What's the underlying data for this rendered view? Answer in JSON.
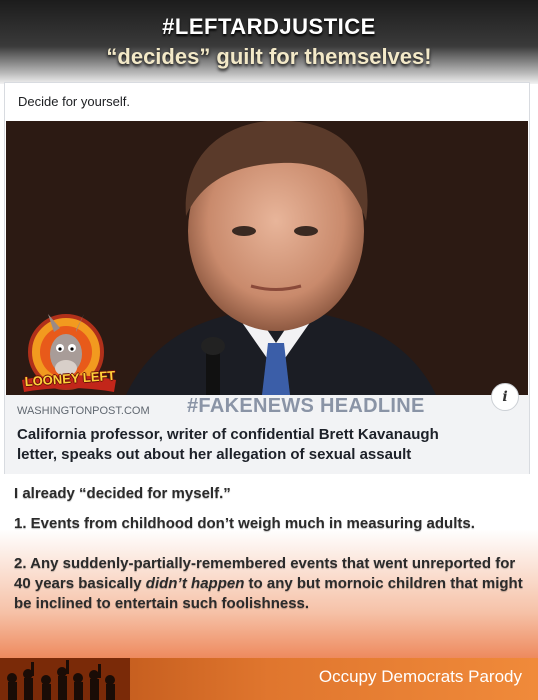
{
  "banner": {
    "line1": "#LEFTARDJUSTICE",
    "line2": "“decides” guilt for themselves!"
  },
  "post": {
    "caption": "Decide for yourself.",
    "domain": "WASHINGTONPOST.COM",
    "stamp": "#FAKENEWS HEADLINE",
    "info_glyph": "i",
    "headline_line1": "California professor, writer of confidential Brett Kavanaugh",
    "headline_line2": "letter, speaks out about her allegation of sexual assault"
  },
  "logo": {
    "text": "LOONEY LEFT",
    "icon": "donkey-mascot-icon",
    "accent": "#f29a1f"
  },
  "comment": {
    "line1": "I already “decided for myself.”",
    "point1": "1. Events from childhood don’t weigh much in measuring adults.",
    "point2_before": "2.  Any suddenly-partially-remembered events that went unreported for 40 years basically ",
    "point2_emphasis": "didn’t happen",
    "point2_after": " to any but mornoic children that might be inclined to entertain such foolishness."
  },
  "footer": {
    "text": "Occupy Democrats Parody",
    "icon": "crowd-silhouette-icon",
    "color": "#e0762e"
  }
}
